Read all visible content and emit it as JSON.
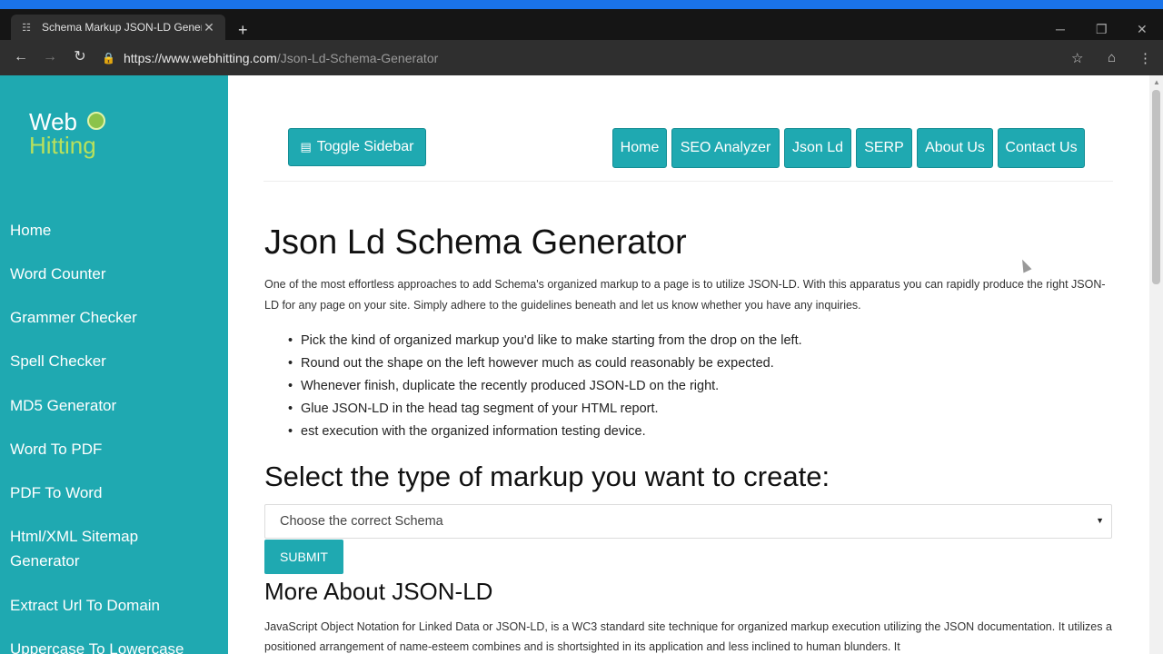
{
  "browser": {
    "tab_title": "Schema Markup JSON-LD Gener",
    "new_tab": "+",
    "url_host": "https://www.webhitting.com",
    "url_path": "/Json-Ld-Schema-Generator"
  },
  "logo": {
    "line1": "Web",
    "line2": "Hitting"
  },
  "sidebar": {
    "items": [
      "Home",
      "Word Counter",
      "Grammer Checker",
      "Spell Checker",
      "MD5 Generator",
      "Word To PDF",
      "PDF To Word",
      "Html/XML Sitemap",
      "Generator",
      "Extract Url To Domain",
      "Uppercase To Lowercase"
    ]
  },
  "topnav": {
    "toggle": "Toggle Sidebar",
    "links": [
      "Home",
      "SEO Analyzer",
      "Json Ld",
      "SERP",
      "About Us",
      "Contact Us"
    ]
  },
  "main": {
    "title": "Json Ld Schema Generator",
    "intro": "One of the most effortless approaches to add Schema's organized markup to a page is to utilize JSON-LD. With this apparatus you can rapidly produce the right JSON-LD for any page on your site. Simply adhere to the guidelines beneath and let us know whether you have any inquiries.",
    "bullets": [
      "Pick the kind of organized markup you'd like to make starting from the drop on the left.",
      "Round out the shape on the left however much as could reasonably be expected.",
      "Whenever finish, duplicate the recently produced JSON-LD on the right.",
      "Glue JSON-LD in the head tag segment of your HTML report.",
      "est execution with the organized information testing device."
    ],
    "select_heading": "Select the type of markup you want to create:",
    "select_value": "Choose the correct Schema",
    "submit": "SUBMIT",
    "more_heading": "More About JSON-LD",
    "more_text": "JavaScript Object Notation for Linked Data or JSON-LD, is a WC3 standard site technique for organized markup execution utilizing the JSON documentation. It utilizes a positioned arrangement of name-esteem combines and is shortsighted in its application and less inclined to human blunders. It"
  },
  "colors": {
    "sidebar": "#1fa9b1",
    "chrome": "#2f2f2f",
    "accent": "#1a73e8"
  }
}
